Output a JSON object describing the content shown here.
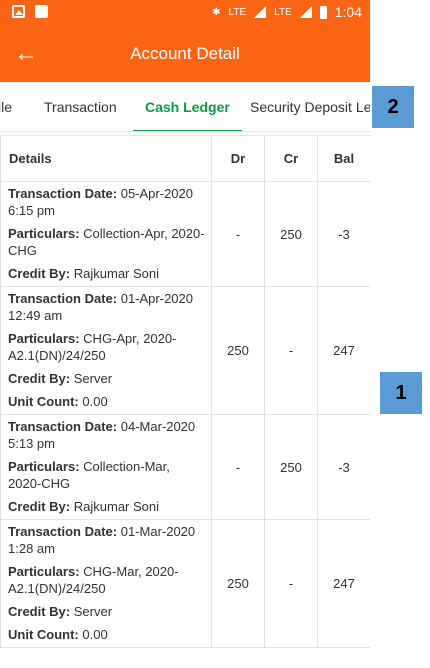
{
  "status_bar": {
    "icons_left": [
      "image-icon",
      "phone-icon"
    ],
    "network": "LTE",
    "time": "1:04"
  },
  "app_bar": {
    "title": "Account Detail",
    "back_icon": "arrow-left-icon"
  },
  "tabs": [
    {
      "label": "ile",
      "active": false
    },
    {
      "label": "Transaction",
      "active": false
    },
    {
      "label": "Cash Ledger",
      "active": true
    },
    {
      "label": "Security Deposit Le",
      "active": false
    }
  ],
  "table": {
    "headers": {
      "details": "Details",
      "dr": "Dr",
      "cr": "Cr",
      "bal": "Bal"
    },
    "field_labels": {
      "date": "Transaction Date:",
      "particulars": "Particulars:",
      "credit_by": "Credit By:",
      "unit_count": "Unit Count:"
    },
    "rows": [
      {
        "date": "05-Apr-2020 6:15 pm",
        "particulars": "Collection-Apr, 2020-CHG",
        "credit_by": "Rajkumar Soni",
        "unit_count": "",
        "dr": "-",
        "cr": "250",
        "bal": "-3"
      },
      {
        "date": "01-Apr-2020 12:49 am",
        "particulars": "CHG-Apr, 2020-A2.1(DN)/24/250",
        "credit_by": "Server",
        "unit_count": "0.00",
        "dr": "250",
        "cr": "-",
        "bal": "247"
      },
      {
        "date": "04-Mar-2020 5:13 pm",
        "particulars": "Collection-Mar, 2020-CHG",
        "credit_by": "Rajkumar Soni",
        "unit_count": "",
        "dr": "-",
        "cr": "250",
        "bal": "-3"
      },
      {
        "date": "01-Mar-2020 1:28 am",
        "particulars": "CHG-Mar, 2020-A2.1(DN)/24/250",
        "credit_by": "Server",
        "unit_count": "0.00",
        "dr": "250",
        "cr": "-",
        "bal": "247"
      }
    ]
  },
  "callouts": [
    "1",
    "2"
  ],
  "colors": {
    "primary": "#fa6412",
    "active_tab": "#0a9b45",
    "callout": "#5b9bd5"
  }
}
